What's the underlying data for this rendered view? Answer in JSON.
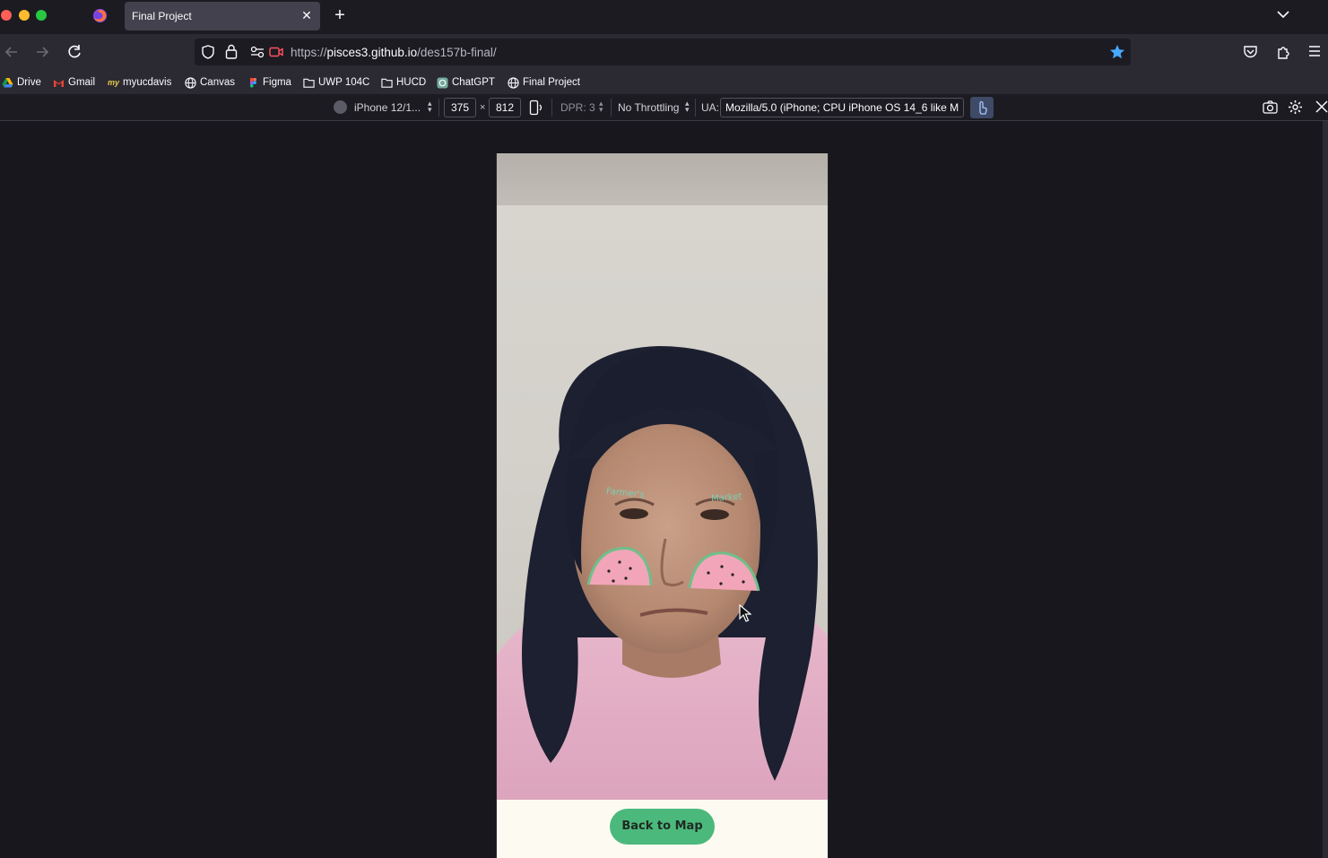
{
  "tab": {
    "title": "Final Project",
    "close": "✕",
    "new_tab": "+"
  },
  "url": {
    "prefix": "https://",
    "host": "pisces3.github.io",
    "path": "/des157b-final/"
  },
  "bookmarks": [
    {
      "label": "Drive",
      "icon": "google-drive-icon"
    },
    {
      "label": "Gmail",
      "icon": "gmail-icon"
    },
    {
      "label": "myucdavis",
      "icon": "myucdavis-icon"
    },
    {
      "label": "Canvas",
      "icon": "globe-icon"
    },
    {
      "label": "Figma",
      "icon": "figma-icon"
    },
    {
      "label": "UWP 104C",
      "icon": "folder-icon"
    },
    {
      "label": "HUCD",
      "icon": "folder-icon"
    },
    {
      "label": "ChatGPT",
      "icon": "chatgpt-icon"
    },
    {
      "label": "Final Project",
      "icon": "globe-icon"
    }
  ],
  "rdm": {
    "device": "iPhone 12/1...",
    "width": "375",
    "times": "×",
    "height": "812",
    "dpr": "DPR: 3",
    "throttling": "No Throttling",
    "ua_label": "UA:",
    "ua_value": "Mozilla/5.0 (iPhone; CPU iPhone OS 14_6 like M"
  },
  "filter": {
    "left_text": "Farmer's",
    "right_text": "Market"
  },
  "page": {
    "back_button": "Back to Map"
  },
  "colors": {
    "accent_green": "#4cb97c",
    "watermelon_pink": "#f2a5b8",
    "rind_green": "#6fbf8a",
    "footer_bg": "#fdfbf1"
  }
}
